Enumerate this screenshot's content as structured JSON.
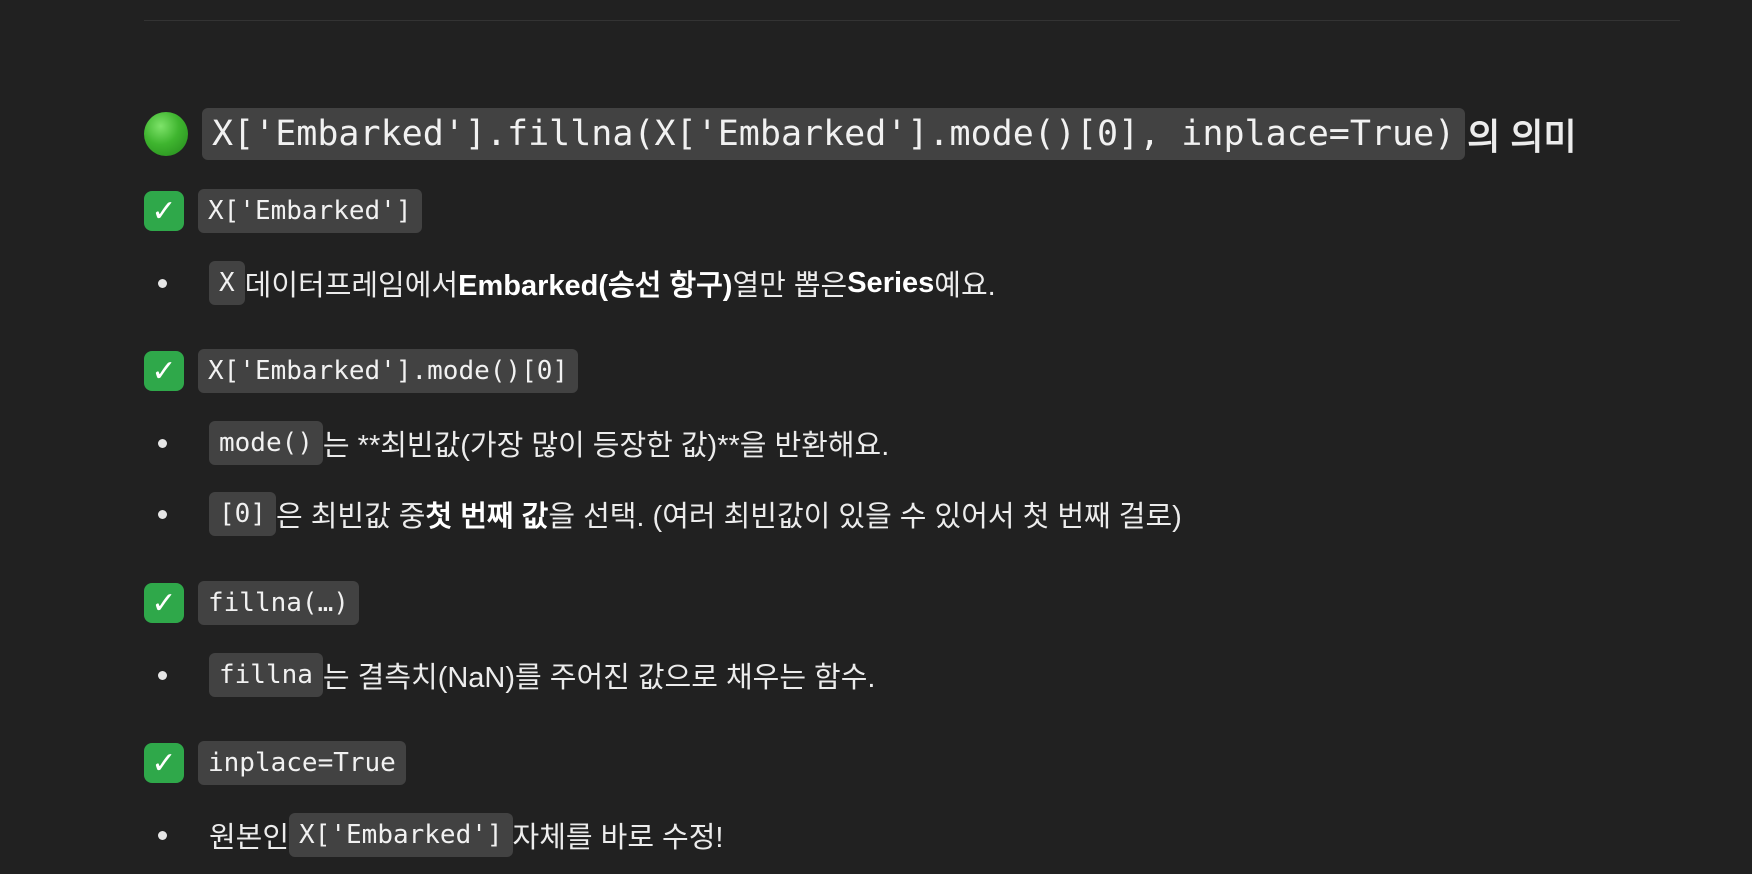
{
  "heading": {
    "code": "X['Embarked'].fillna(X['Embarked'].mode()[0], inplace=True)",
    "suffix": "의 의미"
  },
  "sections": [
    {
      "title_code": "X['Embarked']",
      "bullets": [
        {
          "code": "X",
          "t1": " 데이터프레임에서 ",
          "b1": "Embarked(승선 항구)",
          "t2": " 열만 뽑은 ",
          "b2": "Series",
          "t3": "예요."
        }
      ]
    },
    {
      "title_code": "X['Embarked'].mode()[0]",
      "bullets": [
        {
          "code": "mode()",
          "t1": "는 **최빈값(가장 많이 등장한 값)**을 반환해요."
        },
        {
          "code": "[0]",
          "t1": "은 최빈값 중 ",
          "b1": "첫 번째 값",
          "t2": "을 선택. (여러 최빈값이 있을 수 있어서 첫 번째 걸로)"
        }
      ]
    },
    {
      "title_code": "fillna(…)",
      "bullets": [
        {
          "code": "fillna",
          "t1": "는 결측치(NaN)를 주어진 값으로 채우는 함수."
        }
      ]
    },
    {
      "title_code": "inplace=True",
      "bullets": [
        {
          "t0": "원본인 ",
          "code": "X['Embarked']",
          "t1": " 자체를 바로 수정!"
        }
      ]
    }
  ]
}
